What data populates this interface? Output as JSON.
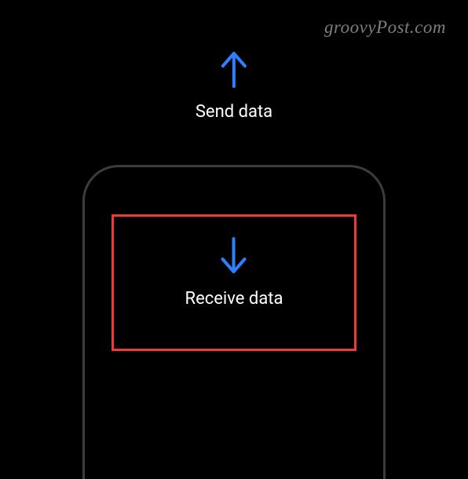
{
  "watermark": "groovyPost.com",
  "send": {
    "label": "Send data",
    "icon_name": "arrow-up-icon"
  },
  "receive": {
    "label": "Receive data",
    "icon_name": "arrow-down-icon"
  },
  "colors": {
    "accent": "#2f7fff",
    "highlight": "#ef3a3a"
  }
}
